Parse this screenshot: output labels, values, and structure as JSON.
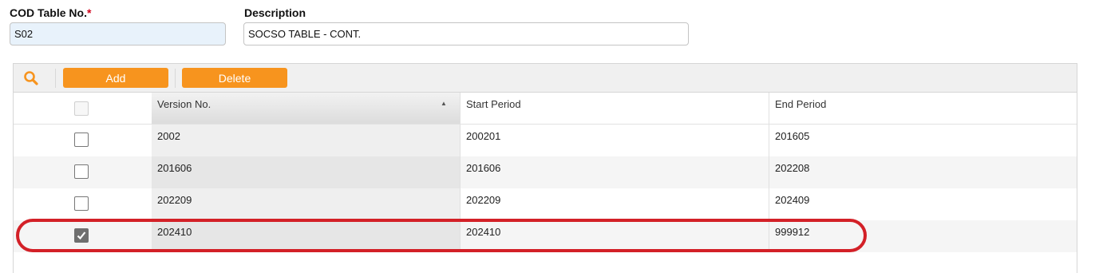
{
  "form": {
    "code_label": "COD Table No.",
    "required_mark": "*",
    "code_value": "S02",
    "description_label": "Description",
    "description_value": "SOCSO TABLE  - CONT."
  },
  "toolbar": {
    "search_icon": "search-icon",
    "add_label": "Add",
    "delete_label": "Delete"
  },
  "table": {
    "columns": [
      "Version No.",
      "Start Period",
      "End Period"
    ],
    "rows": [
      {
        "checked": false,
        "version": "2002",
        "start": "200201",
        "end": "201605"
      },
      {
        "checked": false,
        "version": "201606",
        "start": "201606",
        "end": "202208"
      },
      {
        "checked": false,
        "version": "202209",
        "start": "202209",
        "end": "202409"
      },
      {
        "checked": true,
        "version": "202410",
        "start": "202410",
        "end": "999912"
      }
    ]
  },
  "colors": {
    "accent": "#f7941e",
    "highlight": "#d32027",
    "required": "#d0021b"
  }
}
